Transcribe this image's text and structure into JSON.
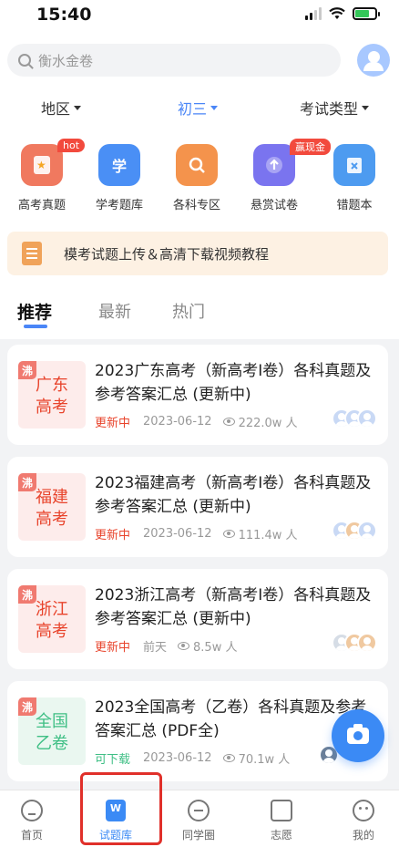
{
  "status": {
    "time": "15:40"
  },
  "search": {
    "placeholder": "衡水金卷"
  },
  "filters": [
    {
      "label": "地区",
      "active": false
    },
    {
      "label": "初三",
      "active": true
    },
    {
      "label": "考试类型",
      "active": false
    }
  ],
  "quick_entries": [
    {
      "label": "高考真题",
      "icon": "bookmark-star-icon",
      "color": "#f0795f",
      "badge": "hot"
    },
    {
      "label": "学考题库",
      "icon": "study-icon",
      "color": "#4a8ff5",
      "glyph": "学",
      "badge": ""
    },
    {
      "label": "各科专区",
      "icon": "search-book-icon",
      "color": "#f4934c",
      "badge": ""
    },
    {
      "label": "悬赏试卷",
      "icon": "upload-icon",
      "color": "#7a74ef",
      "badge": "赢现金"
    },
    {
      "label": "错题本",
      "icon": "wrong-notebook-icon",
      "color": "#4d9bf0",
      "badge": ""
    }
  ],
  "banner": {
    "text": "模考试题上传＆高清下载视频教程"
  },
  "tabs": [
    {
      "label": "推荐",
      "active": true
    },
    {
      "label": "最新",
      "active": false
    },
    {
      "label": "热门",
      "active": false
    }
  ],
  "cards": [
    {
      "hot": "沸",
      "thumb_text": "广东高考",
      "thumb_color": "#e8442c",
      "thumb_bg": "#fdeceb",
      "title": "2023广东高考（新高考Ⅰ卷）各科真题及参考答案汇总 (更新中)",
      "status": "更新中",
      "status_color": "#e8442c",
      "date": "2023-06-12",
      "views": "222.0w 人"
    },
    {
      "hot": "沸",
      "thumb_text": "福建高考",
      "thumb_color": "#e8442c",
      "thumb_bg": "#fdeceb",
      "title": "2023福建高考（新高考Ⅰ卷）各科真题及参考答案汇总 (更新中)",
      "status": "更新中",
      "status_color": "#e8442c",
      "date": "2023-06-12",
      "views": "111.4w 人"
    },
    {
      "hot": "沸",
      "thumb_text": "浙江高考",
      "thumb_color": "#e8442c",
      "thumb_bg": "#fdeceb",
      "title": "2023浙江高考（新高考Ⅰ卷）各科真题及参考答案汇总 (更新中)",
      "status": "更新中",
      "status_color": "#e8442c",
      "date": "前天",
      "views": "8.5w 人"
    },
    {
      "hot": "沸",
      "thumb_text": "全国乙卷",
      "thumb_color": "#3fbf85",
      "thumb_bg": "#eaf7f0",
      "title": "2023全国高考（乙卷）各科真题及参考答案汇总 (PDF全)",
      "status": "可下载",
      "status_color": "#3fbf85",
      "date": "2023-06-12",
      "views": "70.1w 人"
    }
  ],
  "tabbar": [
    {
      "label": "首页",
      "icon": "home-icon",
      "active": false
    },
    {
      "label": "试题库",
      "icon": "question-bank-icon",
      "active": true
    },
    {
      "label": "同学圈",
      "icon": "chat-icon",
      "active": false
    },
    {
      "label": "志愿",
      "icon": "graduation-cap-icon",
      "active": false
    },
    {
      "label": "我的",
      "icon": "profile-face-icon",
      "active": false
    }
  ]
}
